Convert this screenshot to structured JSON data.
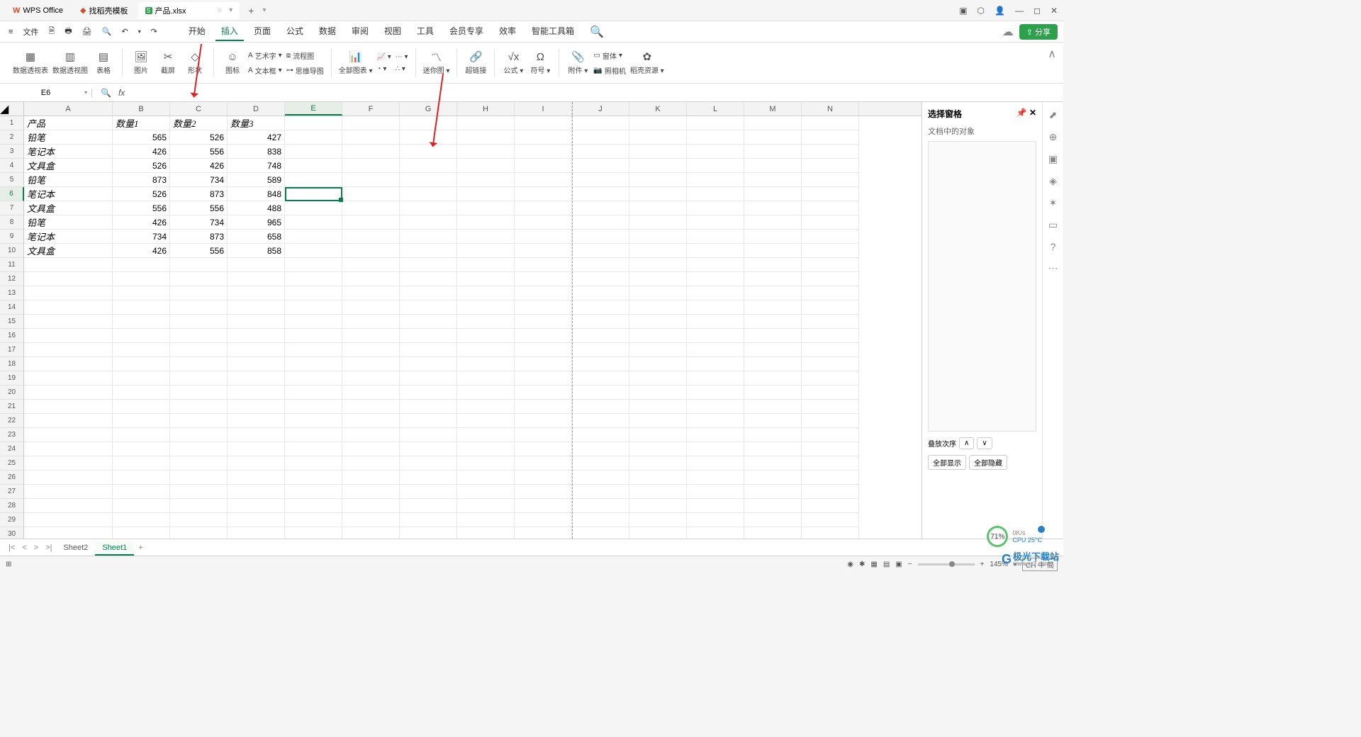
{
  "title_tabs": [
    "WPS Office",
    "找稻壳模板",
    "产品.xlsx"
  ],
  "menu_file": "文件",
  "menu_tabs": [
    "开始",
    "插入",
    "页面",
    "公式",
    "数据",
    "审阅",
    "视图",
    "工具",
    "会员专享",
    "效率",
    "智能工具箱"
  ],
  "menu_active_idx": 1,
  "share_label": "分享",
  "ribbon": {
    "g1": [
      "数据透视表",
      "数据透视图",
      "表格"
    ],
    "g2_top": [
      "图片",
      "截屏",
      "形状"
    ],
    "g3_top": "图标",
    "g3_sub": [
      "艺术字",
      "文本框",
      "流程图",
      "思维导图"
    ],
    "g4": "全部图表",
    "g5": "迷你图",
    "g6": "超链接",
    "g7": [
      "公式",
      "符号"
    ],
    "g8": [
      "附件",
      "照相机",
      "窗体",
      "稻壳资源"
    ]
  },
  "name_box": "E6",
  "col_headers": [
    "A",
    "B",
    "C",
    "D",
    "E",
    "F",
    "G",
    "H",
    "I",
    "J",
    "K",
    "L",
    "M",
    "N"
  ],
  "active_col": "E",
  "active_row": 6,
  "data_rows": [
    [
      "产品",
      "数量1",
      "数量2",
      "数量3"
    ],
    [
      "铅笔",
      "565",
      "526",
      "427"
    ],
    [
      "笔记本",
      "426",
      "556",
      "838"
    ],
    [
      "文具盒",
      "526",
      "426",
      "748"
    ],
    [
      "铅笔",
      "873",
      "734",
      "589"
    ],
    [
      "笔记本",
      "526",
      "873",
      "848"
    ],
    [
      "文具盒",
      "556",
      "556",
      "488"
    ],
    [
      "铅笔",
      "426",
      "734",
      "965"
    ],
    [
      "笔记本",
      "734",
      "873",
      "658"
    ],
    [
      "文具盒",
      "426",
      "556",
      "858"
    ]
  ],
  "total_rows": 30,
  "sheet_tabs": [
    "Sheet2",
    "Sheet1"
  ],
  "active_sheet": 1,
  "side_panel": {
    "title": "选择窗格",
    "subtitle": "文档中的对象",
    "order": "叠放次序",
    "show_all": "全部显示",
    "hide_all": "全部隐藏"
  },
  "zoom": "145%",
  "perf_pct": "71%",
  "perf_speed": "0K/s",
  "perf_cpu": "CPU 25°C",
  "watermark": "极光下载站",
  "watermark_sub": "www.xz7.com",
  "ime": "CH 中 简"
}
